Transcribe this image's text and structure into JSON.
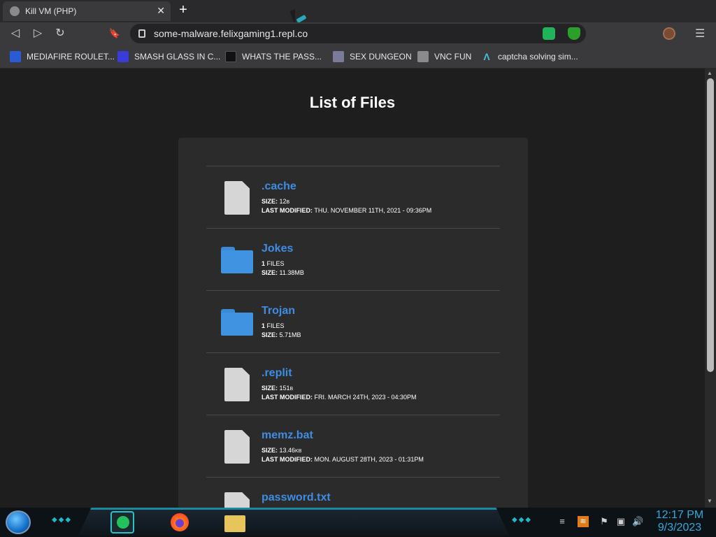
{
  "browser": {
    "tab_title": "Kill VM (PHP)",
    "tab_close": "✕",
    "new_tab": "+",
    "url": "some-malware.felixgaming1.repl.co",
    "nav": {
      "back": "◁",
      "forward": "▷",
      "reload": "↻",
      "bookmark": "🔖",
      "menu": "☰"
    },
    "bookmarks": [
      {
        "label": "MEDIAFIRE ROULET...",
        "color": "#2a5bd7"
      },
      {
        "label": "SMASH GLASS IN C...",
        "color": "#3b3bd9"
      },
      {
        "label": "WHATS THE PASS...",
        "color": "#111111"
      },
      {
        "label": "SEX DUNGEON",
        "color": "#7a7a9a"
      },
      {
        "label": "VNC FUN",
        "color": "#8a8a8a"
      },
      {
        "label": "captcha solving sim...",
        "color": "#3fc1d6"
      }
    ]
  },
  "page": {
    "title": "List of Files",
    "files": [
      {
        "name": ".cache",
        "type": "file",
        "line1_label": "SIZE:",
        "line1_value": " 12",
        "line1_unit": "B",
        "line2_label": "LAST MODIFIED:",
        "line2_value": " THU. NOVEMBER 11TH, 2021 - 09:36PM"
      },
      {
        "name": "Jokes",
        "type": "folder",
        "line1_label": "1",
        "line1_value": " FILES",
        "line1_unit": "",
        "line2_label": "SIZE:",
        "line2_value": " 11.38MB"
      },
      {
        "name": "Trojan",
        "type": "folder",
        "line1_label": "1",
        "line1_value": " FILES",
        "line1_unit": "",
        "line2_label": "SIZE:",
        "line2_value": " 5.71MB"
      },
      {
        "name": ".replit",
        "type": "file",
        "line1_label": "SIZE:",
        "line1_value": " 151",
        "line1_unit": "B",
        "line2_label": "LAST MODIFIED:",
        "line2_value": " FRI. MARCH 24TH, 2023 - 04:30PM"
      },
      {
        "name": "memz.bat",
        "type": "file",
        "line1_label": "SIZE:",
        "line1_value": " 13.46",
        "line1_unit": "KB",
        "line2_label": "LAST MODIFIED:",
        "line2_value": " MON. AUGUST 28TH, 2023 - 01:31PM"
      },
      {
        "name": "password.txt",
        "type": "file",
        "line1_label": "",
        "line1_value": "",
        "line1_unit": "",
        "line2_label": "",
        "line2_value": ""
      }
    ]
  },
  "taskbar": {
    "time": "12:17 PM",
    "date": "9/3/2023",
    "accent": "#1fb8c9"
  }
}
